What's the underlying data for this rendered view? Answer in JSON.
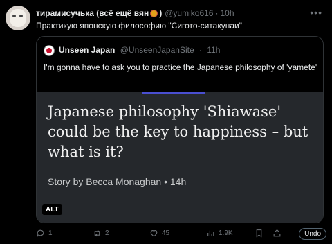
{
  "author": {
    "display_name": "тирамисучька (всё ещё вян",
    "name_paren": ")",
    "handle": "@yumiko616",
    "separator": "·",
    "time": "10h"
  },
  "tweet_text": "Практикую японскую философию \"Сигото-ситакунаи\"",
  "quote": {
    "name": "Unseen Japan",
    "handle": "@UnseenJapanSite",
    "separator": "·",
    "time": "11h",
    "text": "I'm gonna have to ask you to practice the Japanese philosophy of 'yamete'",
    "media": {
      "headline": "Japanese philosophy 'Shiawase' could be the key to happiness – but what is it?",
      "byline": "Story by Becca Monaghan  •  14h",
      "alt_label": "ALT"
    }
  },
  "actions": {
    "replies": "1",
    "retweets": "2",
    "likes": "45",
    "views": "1.9K",
    "undo_label": "Undo"
  },
  "colors": {
    "background": "#000000",
    "media_background": "#25282c",
    "muted_text": "#71767b",
    "accent_bar": "#4a4fd1"
  }
}
